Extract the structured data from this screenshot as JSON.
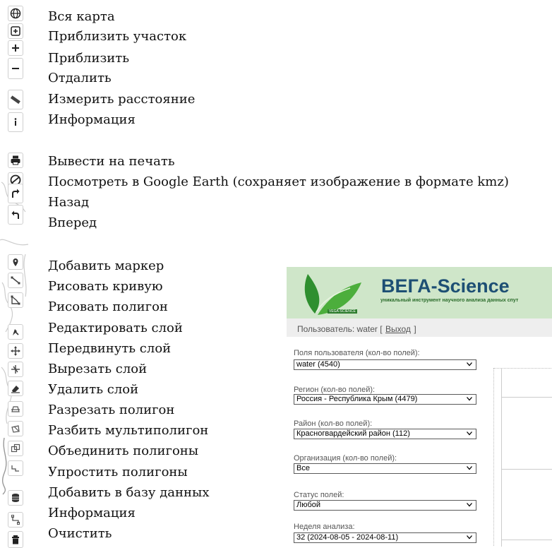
{
  "legend": {
    "items": [
      "Вся карта",
      "Приблизить участок",
      "Приблизить",
      "Отдалить",
      "Измерить расстояние",
      "Информация",
      "Вывести на печать",
      "Посмотреть в Google Earth (сохраняет изображение в формате kmz)",
      "Назад",
      "Вперед",
      "Добавить маркер",
      "Рисовать кривую",
      "Рисовать полигон",
      "Редактировать слой",
      "Передвинуть слой",
      "Вырезать слой",
      "Удалить слой",
      "Разрезать полигон",
      "Разбить мультиполигон",
      "Объединить полигоны",
      "Упростить полигоны",
      "Добавить в базу данных",
      "Информация",
      "Очистить"
    ]
  },
  "toolbar": {
    "icons": [
      "globe-icon",
      "zoom-area-icon",
      "zoom-in-icon",
      "zoom-out-icon",
      "ruler-icon",
      "info-icon",
      "print-icon",
      "google-earth-icon",
      "back-icon",
      "forward-icon",
      "marker-icon",
      "polyline-icon",
      "polygon-icon",
      "edit-layer-icon",
      "move-layer-icon",
      "cut-layer-icon",
      "delete-layer-icon",
      "split-polygon-icon",
      "explode-multipolygon-icon",
      "merge-polygons-icon",
      "simplify-polygons-icon",
      "database-icon",
      "info-icon-2",
      "clear-icon"
    ]
  },
  "app": {
    "brand": "ВЕГА-Science",
    "tagline": "уникальный инструмент научного анализа данных спут",
    "logo_caption": "VEGA-SCIENCE",
    "user_prefix": "Пользователь: water [",
    "logout": "Выход",
    "user_suffix": "]",
    "fields": [
      {
        "label": "Поля пользователя (кол-во полей):",
        "value": "water (4540)"
      },
      {
        "label": "Регион (кол-во полей):",
        "value": "Россия - Республика Крым (4479)"
      },
      {
        "label": "Район (кол-во полей):",
        "value": "Красногвардейский район (112)"
      },
      {
        "label": "Организация (кол-во полей):",
        "value": "Все"
      },
      {
        "label": "Статус полей:",
        "value": "Любой"
      },
      {
        "label": "Неделя анализа:",
        "value": "32  (2024-08-05 - 2024-08-11)"
      }
    ],
    "colors": {
      "banner": "#cfe6c9",
      "brand": "#1d4f74",
      "link": "#1a4fa8"
    }
  }
}
